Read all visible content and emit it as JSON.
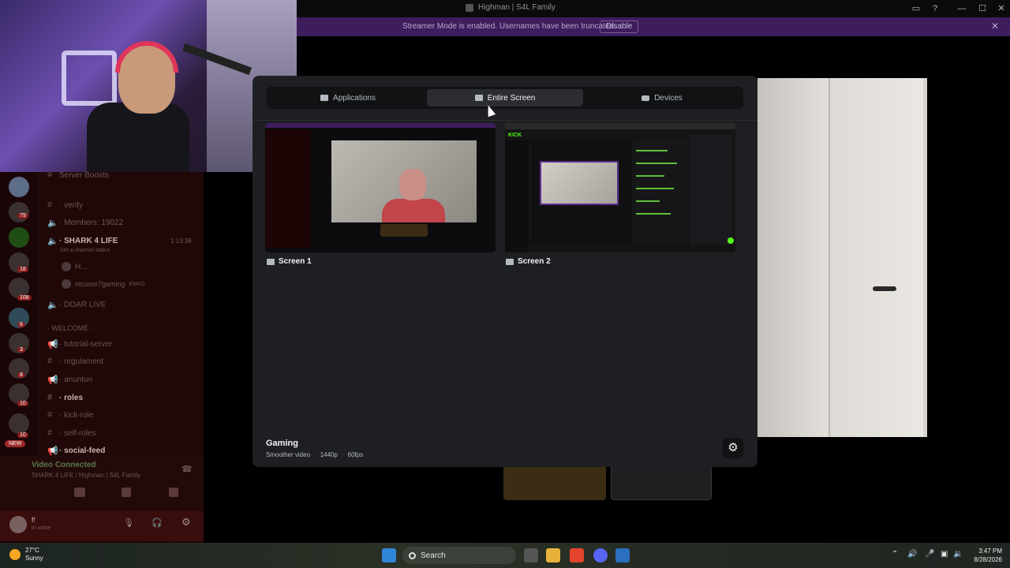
{
  "window": {
    "title": "Highman | S4L Family",
    "controls": [
      "—",
      "☐",
      "✕"
    ]
  },
  "streamer_bar": {
    "message": "Streamer Mode is enabled. Usernames have been truncated.",
    "disable_label": "Disable",
    "close": "✕"
  },
  "sidebar": {
    "rows": [
      {
        "icon": "#",
        "label": "Server Boosts"
      },
      {
        "icon": "#",
        "label": "· verify"
      },
      {
        "icon": "🔈",
        "label": "· Members: 19022"
      },
      {
        "icon": "🔈",
        "label": "· SHARK 4 LIFE",
        "time": "1:13:38"
      },
      {
        "icon": "",
        "label": "Set a channel status"
      },
      {
        "icon": "",
        "label": "H..."
      },
      {
        "icon": "",
        "label": "nicusor7gaming",
        "tag": "ENKO"
      },
      {
        "icon": "🔈",
        "label": "· DOAR LIVE"
      },
      {
        "icon": "",
        "label": "· WELCOME ·"
      },
      {
        "icon": "📢",
        "label": "· tutorial-server"
      },
      {
        "icon": "#",
        "label": "· regulament"
      },
      {
        "icon": "📢",
        "label": "· anunturi"
      },
      {
        "icon": "#",
        "label": "· roles"
      },
      {
        "icon": "#",
        "label": "· kick-role"
      },
      {
        "icon": "#",
        "label": "· self-roles"
      },
      {
        "icon": "📢",
        "label": "· social-feed"
      }
    ],
    "rail_badges": [
      "79",
      "18",
      "108",
      "6",
      "3",
      "8",
      "10",
      "10"
    ],
    "new_badge": "NEW",
    "voice": {
      "status": "Video Connected",
      "channel": "SHARK 4 LIFE / Highman | S4L Family"
    },
    "user": {
      "name": "f!",
      "status": "In voice"
    }
  },
  "modal": {
    "tabs": [
      {
        "label": "Applications",
        "icon": "window-icon",
        "active": false
      },
      {
        "label": "Entire Screen",
        "icon": "monitor-icon",
        "active": true
      },
      {
        "label": "Devices",
        "icon": "camera-icon",
        "active": false
      }
    ],
    "screens": [
      {
        "label": "Screen 1"
      },
      {
        "label": "Screen 2"
      }
    ],
    "quality": {
      "title": "Gaming",
      "desc": "Smoother video",
      "resolution": "1440p",
      "fps": "60fps"
    },
    "screen2_logo": "KICK"
  },
  "taskbar": {
    "temp": "27°C",
    "weather": "Sunny",
    "search_placeholder": "Search",
    "time": "3:47 PM",
    "date": "8/28/2026"
  },
  "colors": {
    "accent_streamer": "#3d1d5e",
    "modal_bg": "#1e1f22",
    "kick_green": "#53fc18"
  }
}
